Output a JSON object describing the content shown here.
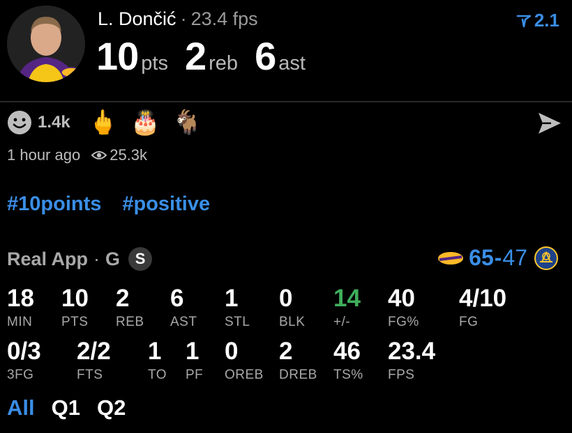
{
  "player": {
    "name": "L. Dončić",
    "separator": "·",
    "fps": "23.4 fps",
    "pts_value": "10",
    "pts_unit": "pts",
    "reb_value": "2",
    "reb_unit": "reb",
    "ast_value": "6",
    "ast_unit": "ast",
    "avatar_icon": "player-headshot-icon"
  },
  "bookmark": {
    "value": "2.1",
    "icon": "filter-arrow-icon"
  },
  "reactions": {
    "count": "1.4k",
    "smiley_icon": "smiley-face-icon",
    "emojis": [
      "🖕",
      "🎂",
      "🐐"
    ]
  },
  "meta": {
    "time": "1 hour ago",
    "views": "25.3k",
    "eye_icon": "eye-icon"
  },
  "tags": [
    "#10points",
    "#positive"
  ],
  "game": {
    "source": "Real App",
    "separator": "·",
    "grade": "G",
    "badge": "S",
    "home_score": "65",
    "dash": "-",
    "away_score": "47",
    "home_icon": "lakers-logo-icon",
    "away_icon": "warriors-logo-icon"
  },
  "stats_row1": [
    {
      "value": "18",
      "label": "MIN"
    },
    {
      "value": "10",
      "label": "PTS"
    },
    {
      "value": "2",
      "label": "REB"
    },
    {
      "value": "6",
      "label": "AST"
    },
    {
      "value": "1",
      "label": "STL"
    },
    {
      "value": "0",
      "label": "BLK"
    },
    {
      "value": "14",
      "label": "+/-"
    },
    {
      "value": "40",
      "label": "FG%"
    },
    {
      "value": "4/10",
      "label": "FG"
    }
  ],
  "stats_row2": [
    {
      "value": "0/3",
      "label": "3FG"
    },
    {
      "value": "2/2",
      "label": "FTS"
    },
    {
      "value": "1",
      "label": "TO"
    },
    {
      "value": "1",
      "label": "PF"
    },
    {
      "value": "0",
      "label": "OREB"
    },
    {
      "value": "2",
      "label": "DREB"
    },
    {
      "value": "46",
      "label": "TS%"
    },
    {
      "value": "23.4",
      "label": "FPS"
    }
  ],
  "tabs": [
    "All",
    "Q1",
    "Q2"
  ],
  "colors": {
    "accent": "#3a8ee6",
    "positive": "#3fae5c",
    "muted": "#a8a8a8"
  }
}
